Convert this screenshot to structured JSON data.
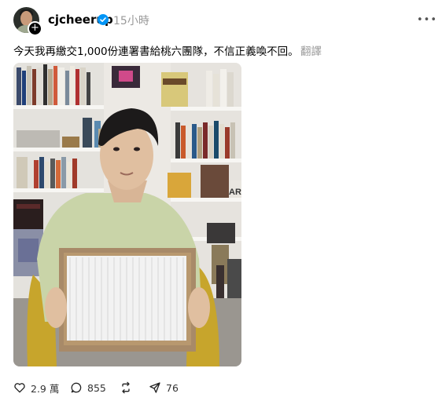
{
  "post": {
    "username": "cjcheerup",
    "timestamp": "15小時",
    "text": "今天我再繳交1,000份連署書給桃六團隊，不信正義喚不回。",
    "translate_label": "翻譯"
  },
  "actions": {
    "likes": "2.9 萬",
    "comments": "855",
    "shares": "76"
  },
  "icons": [
    "plus-icon",
    "verified-icon",
    "more-icon",
    "heart-icon",
    "comment-icon",
    "repost-icon",
    "send-icon"
  ],
  "colors": {
    "verified": "#0095f6",
    "muted": "#999999",
    "sweater": "#c9d4a8",
    "chair": "#c7a52c"
  }
}
